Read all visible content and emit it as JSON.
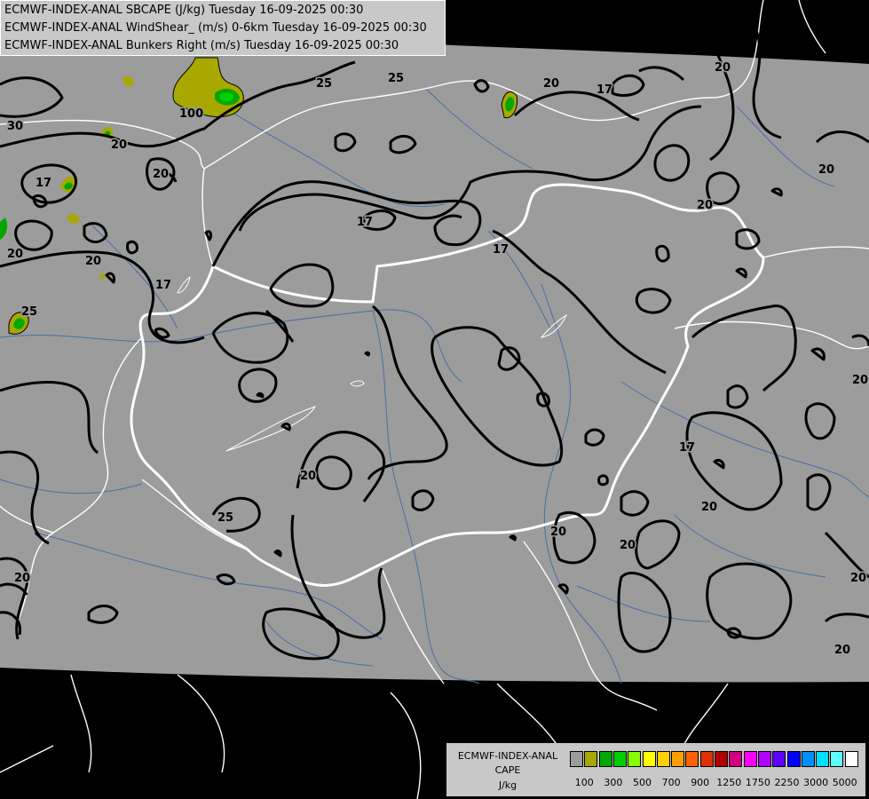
{
  "titles": [
    "ECMWF-INDEX-ANAL SBCAPE (J/kg) Tuesday 16-09-2025 00:30",
    "ECMWF-INDEX-ANAL WindShear_ (m/s) 0-6km Tuesday 16-09-2025 00:30",
    "ECMWF-INDEX-ANAL Bunkers Right (m/s) Tuesday 16-09-2025 00:30"
  ],
  "legend": {
    "title_line1": "ECMWF-INDEX-ANAL",
    "title_line2": "CAPE",
    "unit": "J/kg",
    "colors": [
      "#9c9c9c",
      "#a8a800",
      "#00a800",
      "#00d000",
      "#88ff00",
      "#ffff00",
      "#ffd000",
      "#ffa000",
      "#ff6000",
      "#e03000",
      "#b00000",
      "#d00080",
      "#ff00ff",
      "#b000ff",
      "#6000ff",
      "#0000ff",
      "#0090ff",
      "#00e0ff",
      "#60ffff",
      "#ffffff"
    ],
    "ticks": [
      "100",
      "300",
      "500",
      "700",
      "900",
      "1250",
      "1750",
      "2250",
      "3000",
      "5000"
    ]
  },
  "contour_labels": [
    "25",
    "25",
    "20",
    "17",
    "20",
    "17",
    "30",
    "20",
    "20",
    "17",
    "20",
    "20",
    "25",
    "17",
    "20",
    "20",
    "20",
    "20",
    "25",
    "20",
    "20",
    "20",
    "17",
    "20",
    "17",
    "20",
    "20",
    "100"
  ],
  "cape_colors": {
    "low": "#a8a800",
    "mid": "#00a800",
    "high": "#00d000"
  }
}
